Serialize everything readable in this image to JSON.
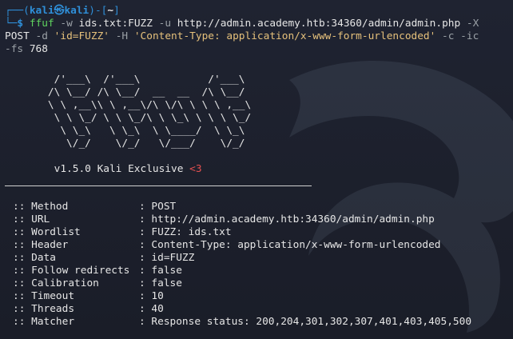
{
  "prompt": {
    "frame_top": "┌──(",
    "user_host": "kali㉿kali",
    "frame_mid": ")-[",
    "cwd": "~",
    "frame_end": "]",
    "frame_bottom": "└─",
    "dollar": "$"
  },
  "command": {
    "program": "ffuf",
    "line1_args": [
      {
        "t": " -w ",
        "k": "flag"
      },
      {
        "t": "ids.txt:FUZZ",
        "k": "arg"
      },
      {
        "t": " -u ",
        "k": "flag"
      },
      {
        "t": "http://admin.academy.htb:34360/admin/admin.php",
        "k": "arg"
      },
      {
        "t": " -X",
        "k": "flag"
      }
    ],
    "line2": [
      {
        "t": "POST",
        "k": "arg"
      },
      {
        "t": " -d ",
        "k": "flag"
      },
      {
        "t": "'id=FUZZ'",
        "k": "str"
      },
      {
        "t": " -H ",
        "k": "flag"
      },
      {
        "t": "'Content-Type: application/x-www-form-urlencoded'",
        "k": "str"
      },
      {
        "t": " -c -ic",
        "k": "flag"
      }
    ],
    "line3": [
      {
        "t": "-fs",
        "k": "flag"
      },
      {
        "t": " 768",
        "k": "arg"
      }
    ]
  },
  "banner": {
    "art": [
      "        /'___\\  /'___\\           /'___\\",
      "       /\\ \\__/ /\\ \\__/  __  __  /\\ \\__/",
      "       \\ \\ ,__\\\\ \\ ,__\\/\\ \\/\\ \\ \\ \\ ,__\\",
      "        \\ \\ \\_/ \\ \\ \\_/\\ \\ \\_\\ \\ \\ \\ \\_/",
      "         \\ \\_\\   \\ \\_\\  \\ \\____/  \\ \\_\\",
      "          \\/_/    \\/_/   \\/___/    \\/_/"
    ],
    "version": "v1.5.0 Kali Exclusive",
    "heart": "<3"
  },
  "options": [
    {
      "key": ":: Method",
      "value": ": POST"
    },
    {
      "key": ":: URL",
      "value": ": http://admin.academy.htb:34360/admin/admin.php"
    },
    {
      "key": ":: Wordlist",
      "value": ": FUZZ: ids.txt"
    },
    {
      "key": ":: Header",
      "value": ": Content-Type: application/x-www-form-urlencoded"
    },
    {
      "key": ":: Data",
      "value": ": id=FUZZ"
    },
    {
      "key": ":: Follow redirects",
      "value": ": false"
    },
    {
      "key": ":: Calibration",
      "value": ": false"
    },
    {
      "key": ":: Timeout",
      "value": ": 10"
    },
    {
      "key": ":: Threads",
      "value": ": 40"
    },
    {
      "key": ":: Matcher",
      "value": ": Response status: 200,204,301,302,307,401,403,405,500"
    }
  ]
}
